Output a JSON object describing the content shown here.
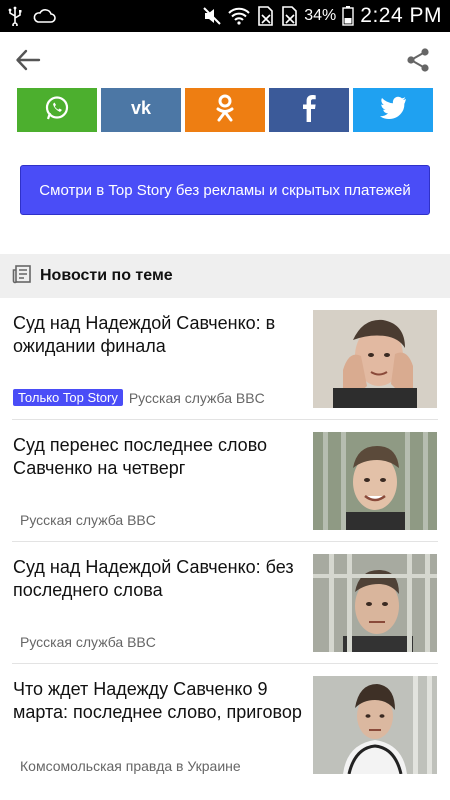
{
  "status_bar": {
    "battery_percent": "34%",
    "time": "2:24 PM"
  },
  "share_buttons": [
    {
      "name": "WhatsApp",
      "icon": "whatsapp-icon",
      "color": "#4caf2e"
    },
    {
      "name": "VK",
      "icon": "vk-icon",
      "color": "#4c77a5"
    },
    {
      "name": "Odnoklassniki",
      "icon": "odnoklassniki-icon",
      "color": "#ee7e12"
    },
    {
      "name": "Facebook",
      "icon": "facebook-icon",
      "color": "#3b5a99"
    },
    {
      "name": "Twitter",
      "icon": "twitter-icon",
      "color": "#1fa1f1"
    }
  ],
  "promo": {
    "label": "Смотри в Top Story без рекламы и скрытых платежей"
  },
  "section": {
    "title": "Новости по теме"
  },
  "news": [
    {
      "headline": "Суд над Надеждой Савченко: в ожидании финала",
      "badge": "Только Top Story",
      "source": "Русская служба BBC"
    },
    {
      "headline": "Суд перенес последнее слово Савченко на четверг",
      "badge": "",
      "source": "Русская служба BBC"
    },
    {
      "headline": "Суд над Надеждой Савченко: без последнего слова",
      "badge": "",
      "source": "Русская служба BBC"
    },
    {
      "headline": "Что ждет Надежду Савченко 9 марта: последнее слово, приговор",
      "badge": "",
      "source": "Комсомольская правда в Украине"
    }
  ]
}
